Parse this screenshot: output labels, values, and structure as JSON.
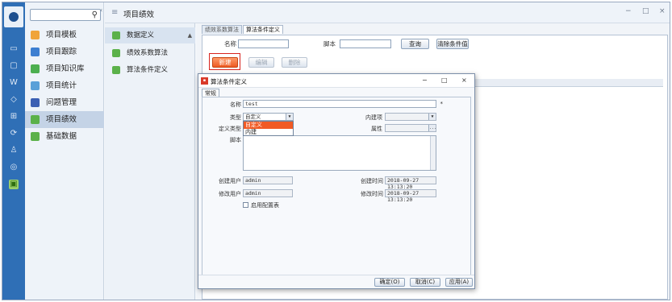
{
  "sidebar": {
    "search_placeholder": "",
    "items": [
      {
        "label": "项目模板",
        "icon": "template-icon",
        "color": "#f0a43a"
      },
      {
        "label": "项目跟踪",
        "icon": "tracking-icon",
        "color": "#3d7fd1"
      },
      {
        "label": "项目知识库",
        "icon": "knowledge-icon",
        "color": "#4caf50"
      },
      {
        "label": "项目统计",
        "icon": "stats-icon",
        "color": "#5aa0d8"
      },
      {
        "label": "问题管理",
        "icon": "issue-icon",
        "color": "#3b5fb3"
      },
      {
        "label": "项目绩效",
        "icon": "performance-icon",
        "color": "#5bb14a"
      },
      {
        "label": "基础数据",
        "icon": "basedata-icon",
        "color": "#5bb14a"
      }
    ],
    "active_index": 5
  },
  "header": {
    "title": "项目绩效",
    "minimize": "−",
    "restore": "□",
    "close": "×"
  },
  "subnav": {
    "items": [
      {
        "label": "数据定义"
      },
      {
        "label": "绩效系数算法"
      },
      {
        "label": "算法条件定义"
      }
    ],
    "caret": "▲"
  },
  "content": {
    "tabs": [
      "绩效系数算法",
      "算法条件定义"
    ],
    "active_tab": 1,
    "filter": {
      "name_label": "名称",
      "script_label": "脚本",
      "query_btn": "查询",
      "clear_btn": "清除条件值"
    },
    "toolbar": {
      "create": "新建",
      "edit": "编辑",
      "delete": "删除"
    }
  },
  "dialog": {
    "title": "算法条件定义",
    "tab": "常规",
    "name_label": "名称",
    "name_value": "test",
    "required_mark": "*",
    "type_label": "类型",
    "type_value": "自定义",
    "type_options": [
      "自定义",
      "内建"
    ],
    "builtin_label": "内建项",
    "define_type_label": "定义类型",
    "attr_label": "属性",
    "attr_btn": "...",
    "script_label": "脚本",
    "create_user_label": "创建用户",
    "create_user_value": "admin",
    "create_time_label": "创建时间",
    "create_time_value": "2018-09-27 13:13:20",
    "modify_user_label": "修改用户",
    "modify_user_value": "admin",
    "modify_time_label": "修改时间",
    "modify_time_value": "2018-09-27 13:13:20",
    "checkbox_label": "启用配置表",
    "ok_btn": "确定(O)",
    "cancel_btn": "取消(C)",
    "apply_btn": "应用(A)",
    "minimize": "−",
    "restore": "□",
    "close": "×"
  }
}
